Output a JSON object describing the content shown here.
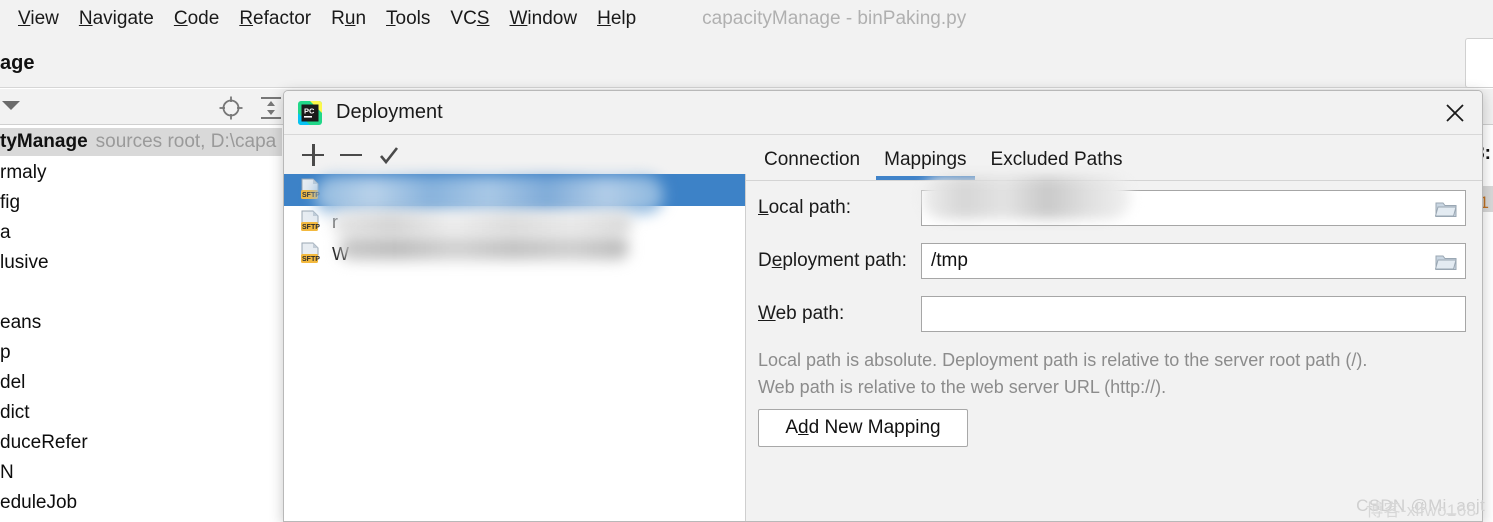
{
  "ide": {
    "menu": [
      {
        "label": "View",
        "mnemonic": "V"
      },
      {
        "label": "Navigate",
        "mnemonic": "N"
      },
      {
        "label": "Code",
        "mnemonic": "C"
      },
      {
        "label": "Refactor",
        "mnemonic": "R"
      },
      {
        "label": "Run",
        "mnemonic": "u"
      },
      {
        "label": "Tools",
        "mnemonic": "T"
      },
      {
        "label": "VCS",
        "mnemonic": "S"
      },
      {
        "label": "Window",
        "mnemonic": "W"
      },
      {
        "label": "Help",
        "mnemonic": "H"
      }
    ],
    "window_title": "capacityManage - binPaking.py",
    "subbar_label": "age",
    "toolbar_icons": [
      "locate-icon",
      "collapse-all-icon",
      "chevron-down-icon"
    ],
    "project_tree": {
      "root_name": "tyManage",
      "root_meta": "sources root,  D:\\capa",
      "items": [
        "rmaly",
        "fig",
        "a",
        "lusive",
        "",
        "eans",
        "p",
        "del",
        "dict",
        "duceRefer",
        "N",
        "eduleJob"
      ]
    },
    "editor_remnant": {
      "line_marker": "3:",
      "gutter_number": "1"
    }
  },
  "dialog": {
    "title": "Deployment",
    "app_icon": "pycharm-icon",
    "close_icon": "close-icon",
    "server_toolbar": [
      {
        "name": "add-server-button",
        "icon": "plus-icon"
      },
      {
        "name": "remove-server-button",
        "icon": "minus-icon"
      },
      {
        "name": "set-default-server-button",
        "icon": "check-icon"
      }
    ],
    "servers": [
      {
        "label": "",
        "icon": "sftp-icon",
        "selected": true,
        "redacted": true
      },
      {
        "label": "r",
        "icon": "sftp-icon",
        "selected": false,
        "redacted": true
      },
      {
        "label": "W",
        "icon": "sftp-icon",
        "selected": false,
        "redacted": true
      }
    ],
    "tabs": [
      {
        "label": "Connection",
        "active": false
      },
      {
        "label": "Mappings",
        "active": true
      },
      {
        "label": "Excluded Paths",
        "active": false
      }
    ],
    "fields": [
      {
        "name": "local-path",
        "label_pre": "L",
        "label_mn": "",
        "label_rest": "ocal path:",
        "label_full": "Local path:",
        "value": "",
        "redacted": true,
        "has_browse": true,
        "browse_icon": "folder-icon"
      },
      {
        "name": "deployment-path",
        "label_pre": "D",
        "label_mn": "e",
        "label_rest": "ployment path:",
        "label_full": "Deployment path:",
        "value": "/tmp",
        "redacted": false,
        "has_browse": true,
        "browse_icon": "folder-icon"
      },
      {
        "name": "web-path",
        "label_pre": "",
        "label_mn": "W",
        "label_rest": "eb path:",
        "label_full": "Web path:",
        "value": "",
        "redacted": false,
        "has_browse": false,
        "browse_icon": ""
      }
    ],
    "help_line_1": "Local path is absolute. Deployment path is relative to the server root path (/).",
    "help_line_2": "Web path is relative to the web server URL (http://).",
    "add_mapping_button": {
      "pre": "A",
      "mnemonic": "d",
      "rest": "d New Mapping",
      "full": "Add New Mapping"
    }
  },
  "watermark": {
    "text_a": "CSDN @Mi_aojt",
    "text_b": "博客-xlfwo168"
  },
  "colors": {
    "accent_blue": "#4083c9",
    "selection_blue": "#3d82c7",
    "panel_bg": "#f2f2f2",
    "field_bg": "#ffffff",
    "help_text": "#8c8c8c",
    "sftp_badge": "#f3b93e"
  }
}
